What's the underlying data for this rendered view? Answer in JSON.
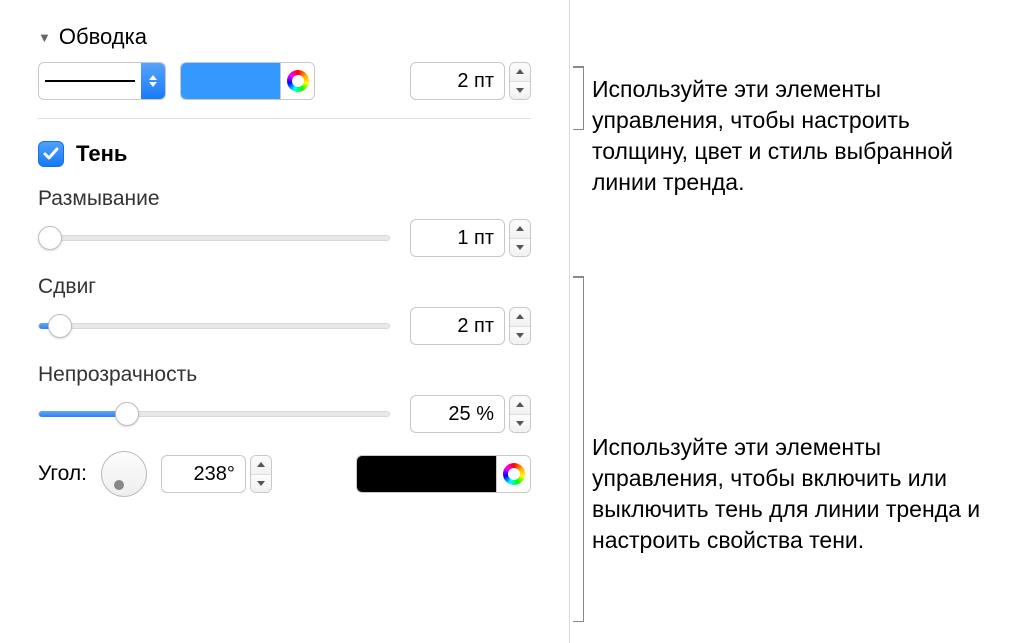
{
  "stroke": {
    "title": "Обводка",
    "width_value": "2 пт",
    "color": "#3399ff"
  },
  "shadow": {
    "enabled": true,
    "title": "Тень",
    "blur": {
      "label": "Размывание",
      "value": "1 пт",
      "percent": 3
    },
    "offset": {
      "label": "Сдвиг",
      "value": "2 пт",
      "percent": 6
    },
    "opacity": {
      "label": "Непрозрачность",
      "value": "25 %",
      "percent": 25
    },
    "angle": {
      "label": "Угол:",
      "value": "238°"
    },
    "color": "#000000"
  },
  "callouts": {
    "stroke": "Используйте эти элементы управления, чтобы настроить толщину, цвет и стиль выбранной линии тренда.",
    "shadow": "Используйте эти элементы управления, чтобы включить или выключить тень для линии тренда и настроить свойства тени."
  }
}
